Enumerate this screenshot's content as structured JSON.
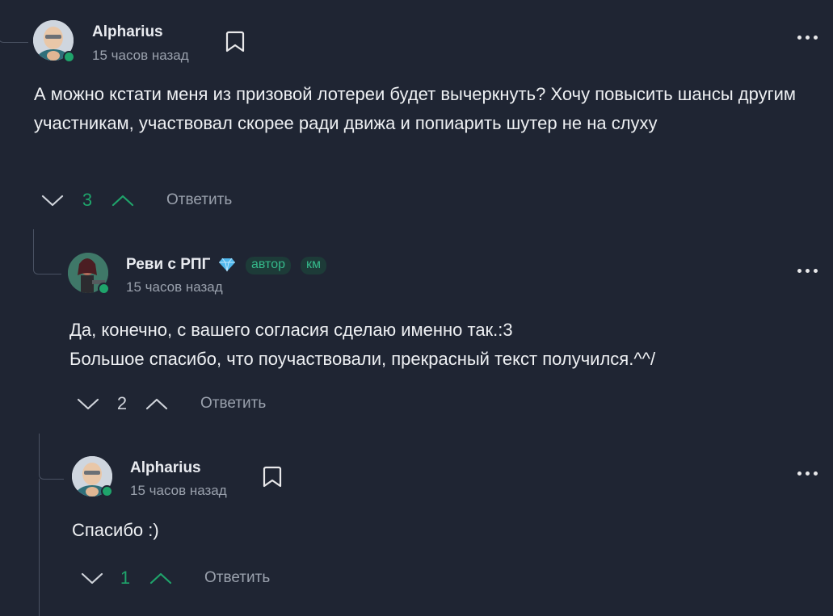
{
  "colors": {
    "background": "#1f2533",
    "accent": "#1fa46b",
    "muted": "#9aa1ad",
    "positive": "#1fa46b"
  },
  "comments": [
    {
      "author": "Alpharius",
      "time": "15 часов назад",
      "text": [
        "А можно кстати меня из призовой лотереи будет вычеркнуть? Хочу повысить шансы другим участникам, участвовал скорее ради движа и попиарить шутер не на слуху"
      ],
      "votes": "3",
      "reply_label": "Ответить"
    },
    {
      "author": "Реви с РПГ",
      "badges": [
        "автор",
        "км"
      ],
      "time": "15 часов назад",
      "text": [
        "Да, конечно, с вашего согласия сделаю именно так.:3",
        "Большое спасибо, что поучаствовали, прекрасный текст получился.^^/"
      ],
      "votes": "2",
      "reply_label": "Ответить"
    },
    {
      "author": "Alpharius",
      "time": "15 часов назад",
      "text": [
        "Спасибо :)"
      ],
      "votes": "1",
      "reply_label": "Ответить"
    }
  ]
}
